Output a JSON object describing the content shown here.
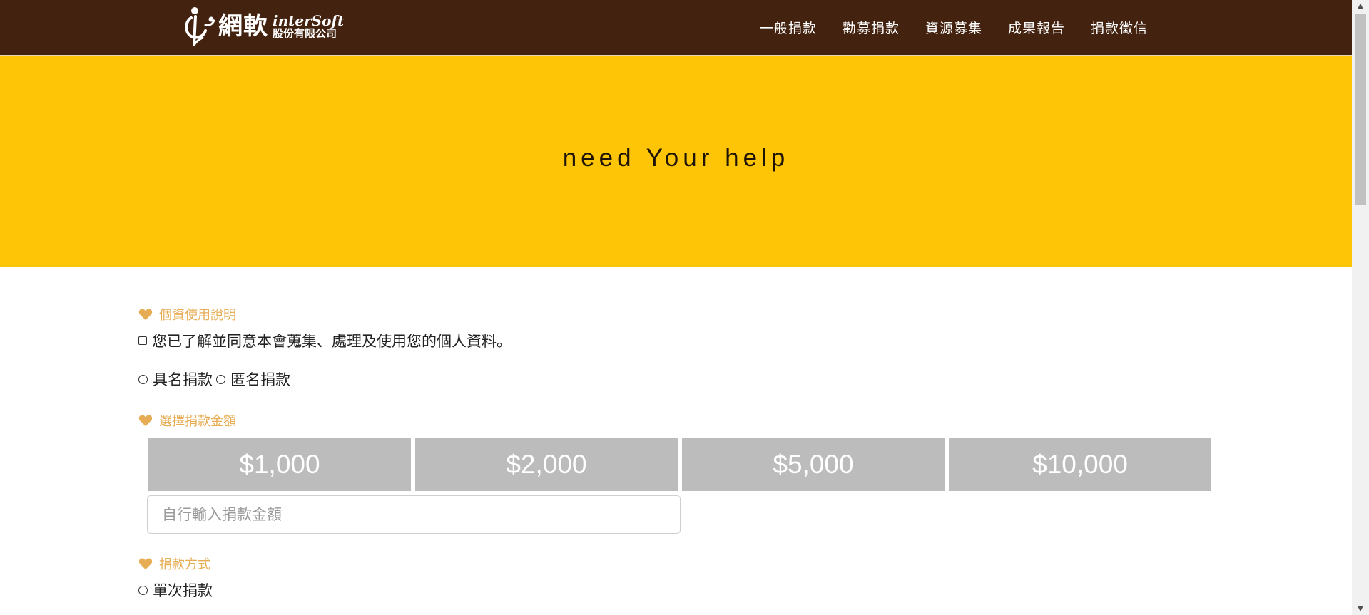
{
  "header": {
    "logo": {
      "name_cn": "網軟",
      "name_en": "interSoft",
      "subtitle": "股份有限公司"
    },
    "nav": [
      {
        "label": "一般捐款"
      },
      {
        "label": "勸募捐款"
      },
      {
        "label": "資源募集"
      },
      {
        "label": "成果報告"
      },
      {
        "label": "捐款徵信"
      }
    ]
  },
  "banner": {
    "text": "need Your help"
  },
  "privacy": {
    "title": "個資使用說明",
    "consent_label": "您已了解並同意本會蒐集、處理及使用您的個人資料。"
  },
  "identity": {
    "named_label": "具名捐款",
    "anonymous_label": "匿名捐款"
  },
  "amount": {
    "title": "選擇捐款金額",
    "options": [
      "$1,000",
      "$2,000",
      "$5,000",
      "$10,000"
    ],
    "custom_placeholder": "自行輸入捐款金額"
  },
  "method": {
    "title": "捐款方式",
    "single_label": "單次捐款"
  },
  "colors": {
    "header_bg": "#43220f",
    "banner_bg": "#fdc506",
    "accent": "#e7ad55",
    "amount_bg": "#bcbcbc"
  },
  "icons": {
    "section": "heart-icon"
  }
}
